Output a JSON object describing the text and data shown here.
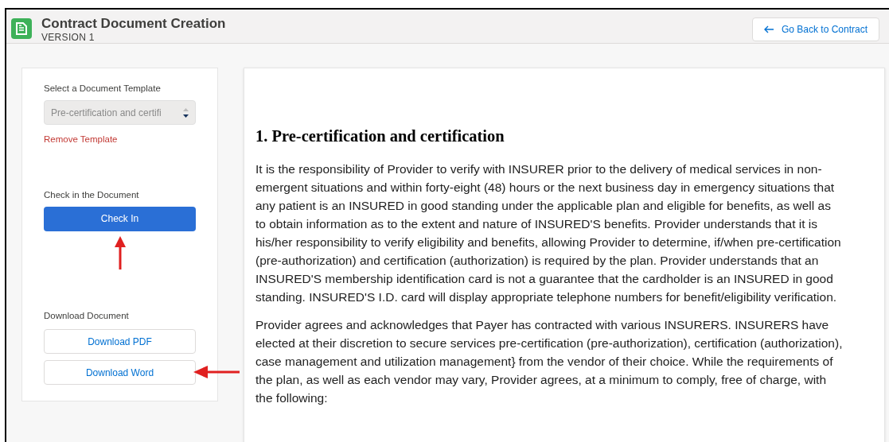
{
  "header": {
    "title": "Contract Document Creation",
    "subtitle": "VERSION 1",
    "back_button": "Go Back to Contract"
  },
  "sidebar": {
    "template_label": "Select a Document Template",
    "template_value": "Pre-certification and certifi",
    "remove_link": "Remove Template",
    "checkin_label": "Check in the Document",
    "checkin_button": "Check In",
    "download_label": "Download Document",
    "download_buttons": [
      "Download PDF",
      "Download Word"
    ]
  },
  "document": {
    "heading": "1. Pre-certification and certification",
    "paragraphs": [
      "It is the responsibility of Provider to verify with INSURER prior to the delivery of medical services in non-emergent situations and within forty-eight (48) hours or the next business day in emergency situations that any patient is an INSURED in good standing under the applicable plan and eligible for benefits, as well as to obtain information as to the extent and nature of INSURED'S benefits. Provider understands that it is his/her responsibility to verify eligibility and benefits, allowing Provider to determine, if/when pre-certification (pre-authorization) and certification (authorization) is required by the plan. Provider understands that an INSURED'S membership identification card is not a guarantee that the cardholder is an INSURED in good standing. INSURED'S I.D. card will display appropriate telephone numbers for benefit/eligibility verification.",
      "Provider agrees and acknowledges that Payer has contracted with various INSURERS. INSURERS have elected at their discretion to secure services pre-certification (pre-authorization), certification (authorization), case management and utilization management} from the vendor of their choice. While the requirements of the plan, as well as each vendor may vary, Provider agrees, at a minimum to comply, free of charge, with the following:"
    ]
  }
}
